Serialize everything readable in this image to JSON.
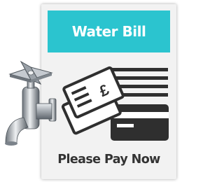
{
  "bill": {
    "title": "Water Bill",
    "footer": "Please Pay Now",
    "currency_symbol": "£"
  },
  "icons": {
    "tap": "water-tap-icon",
    "cheque": "cheque-icon",
    "card": "credit-card-icon",
    "text_lines": "document-lines-icon"
  },
  "colors": {
    "header_background": "#2bc4cf",
    "card_background": "#f2f2f2",
    "text_dark": "#333333",
    "icon_dark": "#2f2f2f"
  }
}
